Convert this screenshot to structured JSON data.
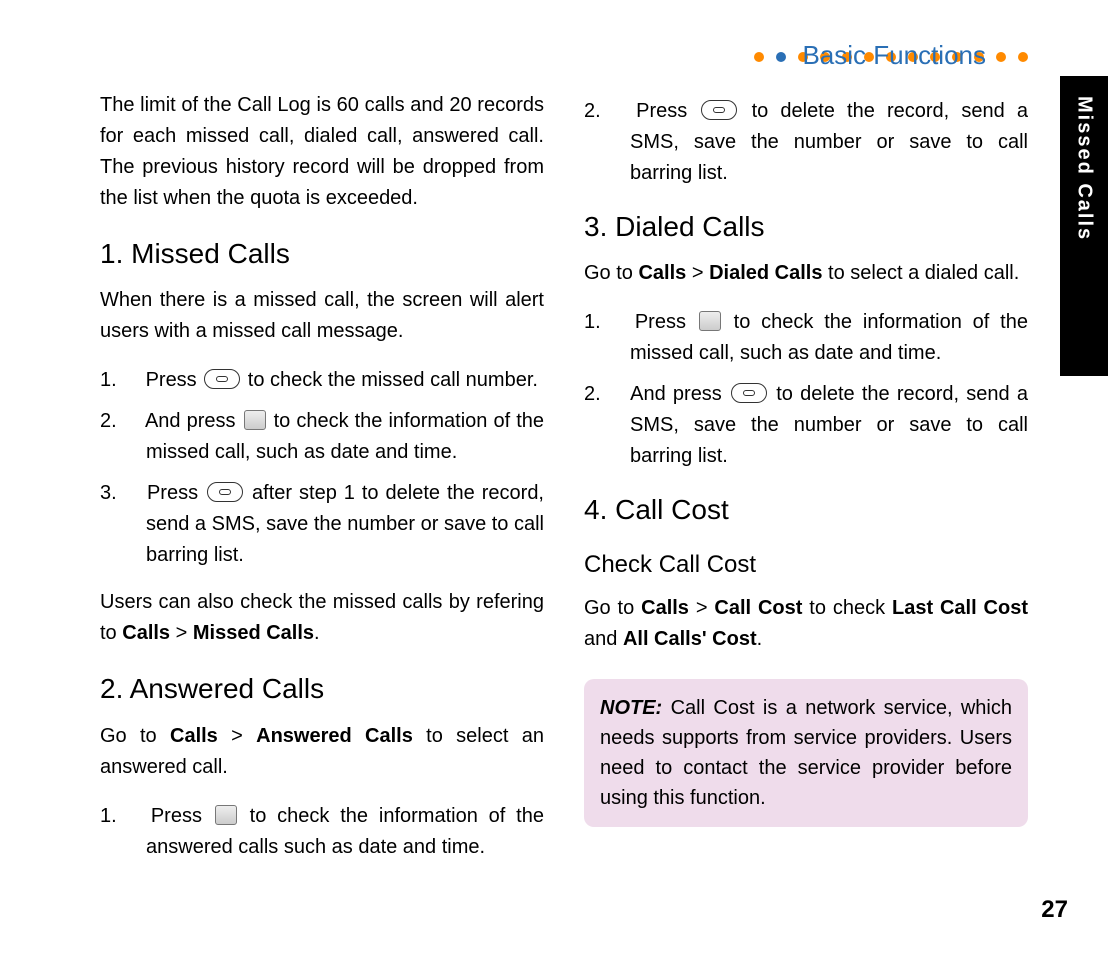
{
  "header": {
    "title": "Basic Functions"
  },
  "side_tab": "Missed Calls",
  "left": {
    "intro": "The limit of the Call Log is 60 calls and 20 records for each missed call, dialed call, answered call. The previous history record will be dropped from the list when the quota is exceeded.",
    "s1_title": "1. Missed Calls",
    "s1_lead": "When there is a missed call, the screen will alert users with a missed call message.",
    "s1_li1_a": "Press ",
    "s1_li1_b": " to check the missed call number.",
    "s1_li2_a": "And press ",
    "s1_li2_b": " to check the information of the missed call, such as date and time.",
    "s1_li3_a": "Press ",
    "s1_li3_b": " after step 1 to delete the record, send a SMS, save the number or save to call barring list.",
    "s1_tail_a": "Users can also check the missed calls by refering to ",
    "s1_tail_b": "Calls",
    "s1_tail_c": " > ",
    "s1_tail_d": "Missed Calls",
    "s1_tail_e": ".",
    "s2_title": "2. Answered Calls",
    "s2_lead_a": "Go to ",
    "s2_lead_b": "Calls",
    "s2_lead_c": " > ",
    "s2_lead_d": "Answered Calls",
    "s2_lead_e": " to select an answered call.",
    "s2_li1_a": "Press ",
    "s2_li1_b": " to check the information of the answered calls such as date and time."
  },
  "right": {
    "s2_li2_a": "Press ",
    "s2_li2_b": " to delete the record, send a SMS, save the number or save to call barring list.",
    "s3_title": "3. Dialed Calls",
    "s3_lead_a": "Go to ",
    "s3_lead_b": "Calls",
    "s3_lead_c": " > ",
    "s3_lead_d": "Dialed Calls",
    "s3_lead_e": " to select a dialed call.",
    "s3_li1_a": "Press ",
    "s3_li1_b": " to check the information of the missed call, such as date and time.",
    "s3_li2_a": "And press ",
    "s3_li2_b": " to delete the record, send a SMS, save the number or save to call barring list.",
    "s4_title": "4. Call Cost",
    "s4_sub": "Check Call Cost",
    "s4_lead_a": "Go to ",
    "s4_lead_b": "Calls",
    "s4_lead_c": " > ",
    "s4_lead_d": "Call Cost",
    "s4_lead_e": " to check ",
    "s4_lead_f": "Last Call Cost",
    "s4_lead_g": " and ",
    "s4_lead_h": "All Calls' Cost",
    "s4_lead_i": ".",
    "note_label": "NOTE:",
    "note_text": " Call Cost is a network service, which needs supports from service providers. Users need to contact the service provider before using this function."
  },
  "page_number": "27"
}
